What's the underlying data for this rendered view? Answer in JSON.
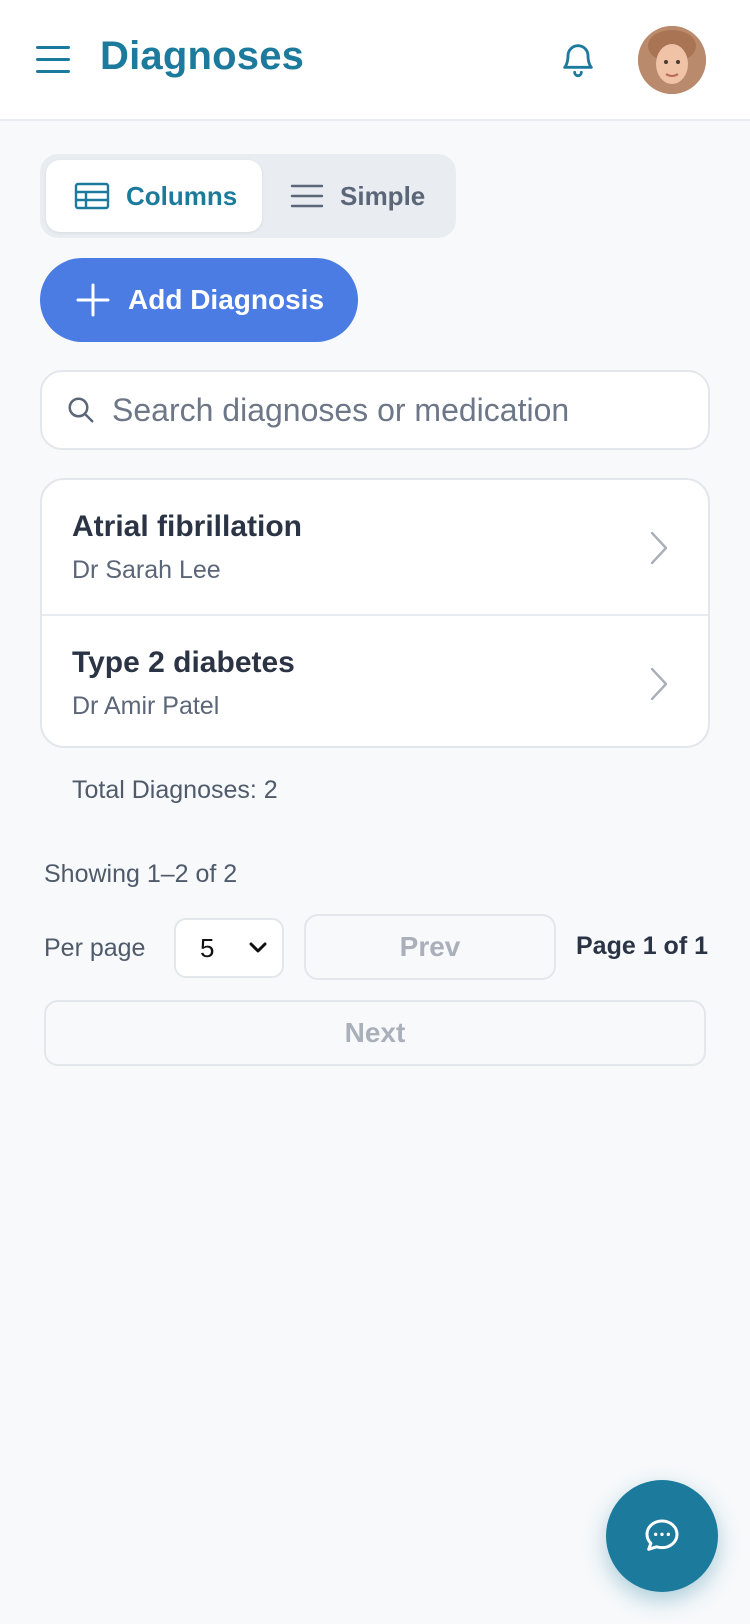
{
  "header": {
    "title": "Diagnoses",
    "menu_icon": "hamburger-menu-icon",
    "notification_icon": "bell-icon",
    "avatar_icon": "user-avatar"
  },
  "view_toggle": {
    "columns_label": "Columns",
    "simple_label": "Simple",
    "active": "Columns"
  },
  "add_button": {
    "label": "Add Diagnosis"
  },
  "search": {
    "placeholder": "Search diagnoses or medication",
    "value": ""
  },
  "diagnoses": [
    {
      "title": "Atrial fibrillation",
      "doctor": "Dr Sarah Lee"
    },
    {
      "title": "Type 2 diabetes",
      "doctor": "Dr Amir Patel"
    }
  ],
  "summary": {
    "total": "Total Diagnoses: 2",
    "showing": "Showing 1–2 of 2"
  },
  "pagination": {
    "per_page_label": "Per page",
    "per_page_value": "5",
    "prev_label": "Prev",
    "page_info": "Page 1 of 1",
    "next_label": "Next"
  },
  "colors": {
    "brand": "#1c7b9c",
    "primary_button": "#4a7ce3",
    "background": "#f7f9fb"
  }
}
